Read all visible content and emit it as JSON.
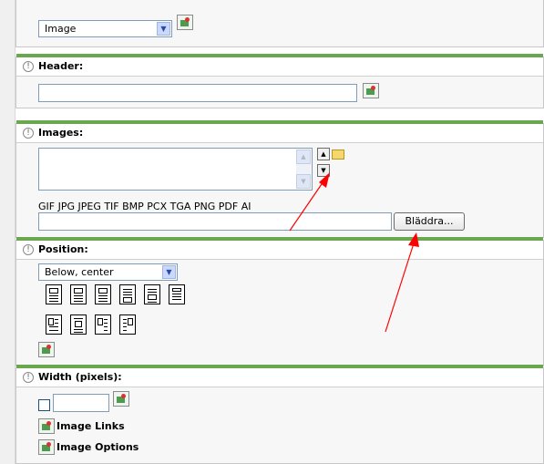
{
  "type_panel": {
    "select_value": "Image"
  },
  "header_panel": {
    "title": "Header:",
    "input_value": ""
  },
  "images_panel": {
    "title": "Images:",
    "formats": "GIF JPG JPEG TIF BMP PCX TGA PNG PDF AI",
    "file_input_value": "",
    "browse_label": "Bläddra..."
  },
  "position_panel": {
    "title": "Position:",
    "select_value": "Below, center"
  },
  "width_panel": {
    "title": "Width (pixels):",
    "input_value": "",
    "image_links_label": "Image Links",
    "image_options_label": "Image Options"
  },
  "colors": {
    "accent_green": "#6aa84f",
    "annotation_red": "#ff0000"
  }
}
